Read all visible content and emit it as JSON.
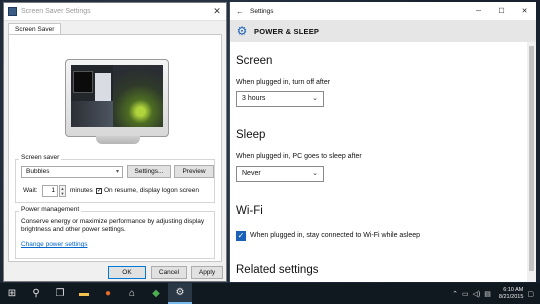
{
  "screensaver_dialog": {
    "title": "Screen Saver Settings",
    "tab": "Screen Saver",
    "screensaver_group_label": "Screen saver",
    "selected_screensaver": "Bubbles",
    "settings_button": "Settings...",
    "preview_button": "Preview",
    "wait_label": "Wait:",
    "wait_value": "1",
    "minutes_label": "minutes",
    "resume_checkbox_label": "On resume, display logon screen",
    "resume_checked": true,
    "power_group_label": "Power management",
    "power_text": "Conserve energy or maximize performance by adjusting display brightness and other power settings.",
    "power_link": "Change power settings",
    "ok_button": "OK",
    "cancel_button": "Cancel",
    "apply_button": "Apply"
  },
  "settings_window": {
    "title": "Settings",
    "header": "POWER & SLEEP",
    "screen_section": "Screen",
    "screen_label": "When plugged in, turn off after",
    "screen_value": "3 hours",
    "sleep_section": "Sleep",
    "sleep_label": "When plugged in, PC goes to sleep after",
    "sleep_value": "Never",
    "wifi_section": "Wi-Fi",
    "wifi_label": "When plugged in, stay connected to Wi-Fi while asleep",
    "wifi_checked": true,
    "related_section": "Related settings"
  },
  "taskbar": {
    "time": "6:10 AM",
    "date": "8/21/2015",
    "icons": [
      "windows-start",
      "search",
      "task-view",
      "file-explorer",
      "firefox",
      "store",
      "network-app",
      "settings"
    ]
  },
  "colors": {
    "accent": "#1a62b8",
    "taskbar": "#101820",
    "link": "#0066cc"
  }
}
